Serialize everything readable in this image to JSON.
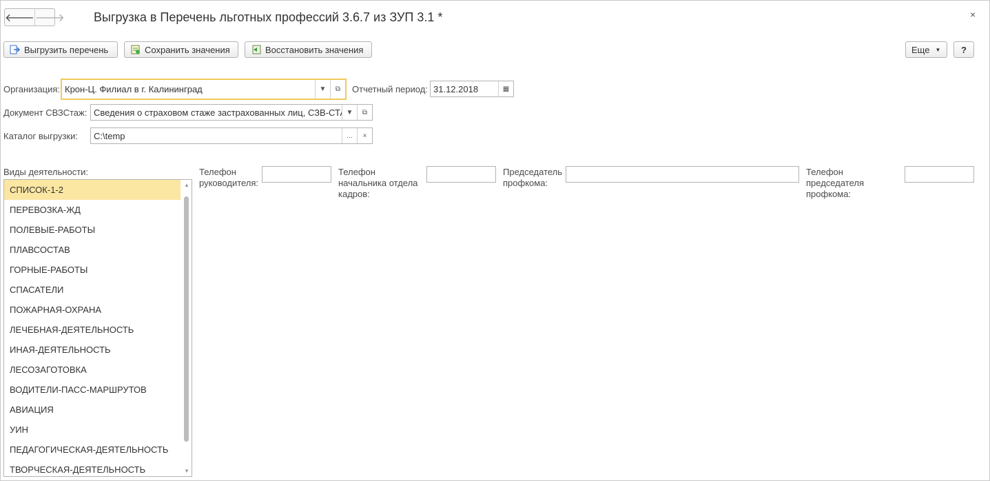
{
  "window": {
    "title": "Выгрузка в Перечень льготных профессий 3.6.7 из ЗУП 3.1 *",
    "back": "🡐",
    "forward": "🡒",
    "close": "×"
  },
  "toolbar": {
    "export_label": "Выгрузить перечень",
    "save_label": "Сохранить значения",
    "restore_label": "Восстановить значения",
    "more_label": "Еще",
    "help_label": "?"
  },
  "form": {
    "org_label": "Организация:",
    "org_value": "Крон-Ц. Филиал в г. Калининград",
    "period_label": "Отчетный период:",
    "period_value": "31.12.2018",
    "doc_label": "Документ СВЗСтаж:",
    "doc_value": "Сведения о страховом стаже застрахованных лиц, СЗВ-СТАЖ",
    "catalog_label": "Каталог выгрузки:",
    "catalog_value": "C:\\temp",
    "catalog_select": "...",
    "catalog_clear": "×"
  },
  "phones": {
    "head_label": "Телефон руководителя:",
    "hr_label": "Телефон начальника отдела кадров:",
    "union_chair_label": "Председатель профкома:",
    "union_phone_label": "Телефон председателя профкома:"
  },
  "activities": {
    "label": "Виды деятельности:",
    "items": [
      "СПИСОК-1-2",
      "ПЕРЕВОЗКА-ЖД",
      "ПОЛЕВЫЕ-РАБОТЫ",
      "ПЛАВСОСТАВ",
      "ГОРНЫЕ-РАБОТЫ",
      "СПАСАТЕЛИ",
      "ПОЖАРНАЯ-ОХРАНА",
      "ЛЕЧЕБНАЯ-ДЕЯТЕЛЬНОСТЬ",
      "ИНАЯ-ДЕЯТЕЛЬНОСТЬ",
      "ЛЕСОЗАГОТОВКА",
      "ВОДИТЕЛИ-ПАСС-МАРШРУТОВ",
      "АВИАЦИЯ",
      "УИН",
      "ПЕДАГОГИЧЕСКАЯ-ДЕЯТЕЛЬНОСТЬ",
      "ТВОРЧЕСКАЯ-ДЕЯТЕЛЬНОСТЬ"
    ],
    "selected_index": 0
  },
  "colors": {
    "selection": "#fbe6a2",
    "focus_border": "#f0c95a"
  }
}
